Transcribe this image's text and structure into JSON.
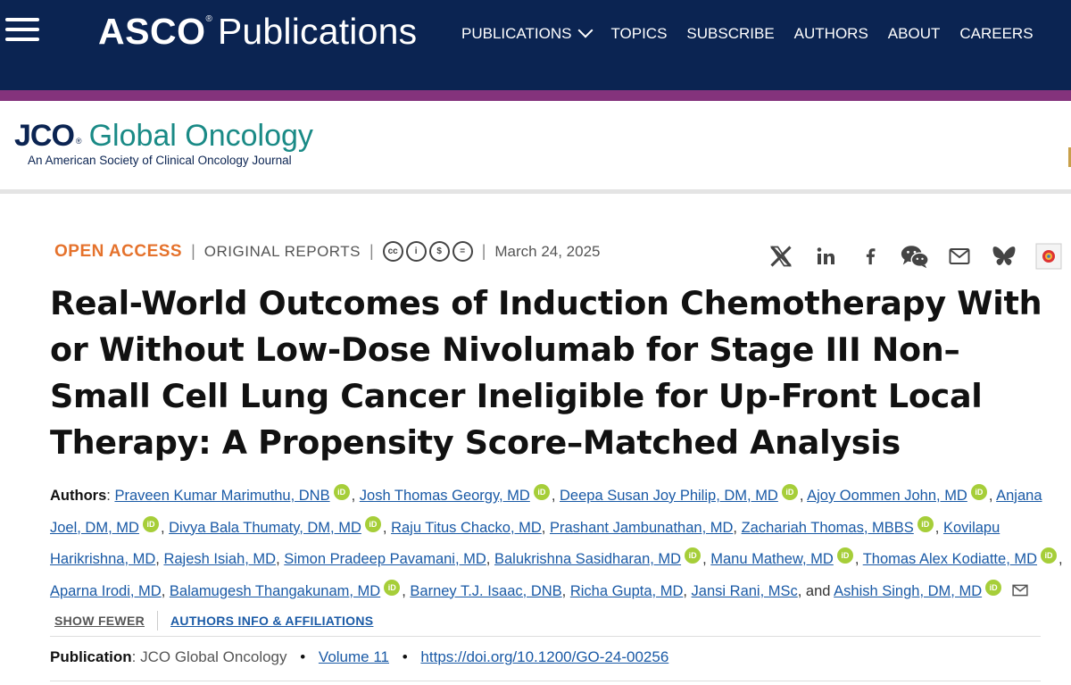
{
  "site": {
    "logo_bold": "ASCO",
    "logo_reg": "®",
    "logo_light": "Publications",
    "nav": [
      "PUBLICATIONS",
      "TOPICS",
      "SUBSCRIBE",
      "AUTHORS",
      "ABOUT",
      "CAREERS"
    ]
  },
  "journal": {
    "abbrev": "JCO",
    "reg": "®",
    "name": "Global Oncology",
    "subtitle": "An American Society of Clinical Oncology Journal"
  },
  "article": {
    "access": "OPEN ACCESS",
    "type": "ORIGINAL REPORTS",
    "date": "March 24, 2025",
    "title": "Real-World Outcomes of Induction Chemotherapy With or Without Low-Dose Nivolumab for Stage III Non–Small Cell Lung Cancer Ineligible for Up-Front Local Therapy: A Propensity Score–Matched Analysis",
    "authors_label": "Authors",
    "authors_colon": ":",
    "and_text": ", and",
    "authors": [
      {
        "name": "Praveen Kumar Marimuthu, DNB",
        "orcid": true
      },
      {
        "name": "Josh Thomas Georgy, MD",
        "orcid": true
      },
      {
        "name": "Deepa Susan Joy Philip, DM, MD",
        "orcid": true
      },
      {
        "name": "Ajoy Oommen John, MD",
        "orcid": true
      },
      {
        "name": "Anjana Joel, DM, MD",
        "orcid": true
      },
      {
        "name": "Divya Bala Thumaty, DM, MD",
        "orcid": true
      },
      {
        "name": "Raju Titus Chacko, MD",
        "orcid": false
      },
      {
        "name": "Prashant Jambunathan, MD",
        "orcid": false
      },
      {
        "name": "Zachariah Thomas, MBBS",
        "orcid": true
      },
      {
        "name": "Kovilapu Harikrishna, MD",
        "orcid": false
      },
      {
        "name": "Rajesh Isiah, MD",
        "orcid": false
      },
      {
        "name": "Simon Pradeep Pavamani, MD",
        "orcid": false
      },
      {
        "name": "Balukrishna Sasidharan, MD",
        "orcid": true
      },
      {
        "name": "Manu Mathew, MD",
        "orcid": true
      },
      {
        "name": "Thomas Alex Kodiatte, MD",
        "orcid": true
      },
      {
        "name": "Aparna Irodi, MD",
        "orcid": false
      },
      {
        "name": "Balamugesh Thangakunam, MD",
        "orcid": true
      },
      {
        "name": "Barney T.J. Isaac, DNB",
        "orcid": false
      },
      {
        "name": "Richa Gupta, MD",
        "orcid": false
      },
      {
        "name": "Jansi Rani, MSc",
        "orcid": false
      },
      {
        "name": "Ashish Singh, DM, MD",
        "orcid": true
      }
    ],
    "show_fewer": "SHOW FEWER",
    "affiliations": "AUTHORS INFO & AFFILIATIONS",
    "publication_label": "Publication",
    "publication_colon": ":",
    "publication_journal": "JCO Global Oncology",
    "volume": "Volume 11",
    "doi": "https://doi.org/10.1200/GO-24-00256"
  },
  "icons": {
    "orcid_text": "iD",
    "cc": [
      "cc",
      "i",
      "$",
      "="
    ]
  },
  "colors": {
    "topbar": "#0b2452",
    "accent": "#84337c",
    "open_access": "#e5722c",
    "link": "#1a5aa6",
    "orcid": "#a6ce39",
    "journal_teal": "#1a8a86"
  }
}
